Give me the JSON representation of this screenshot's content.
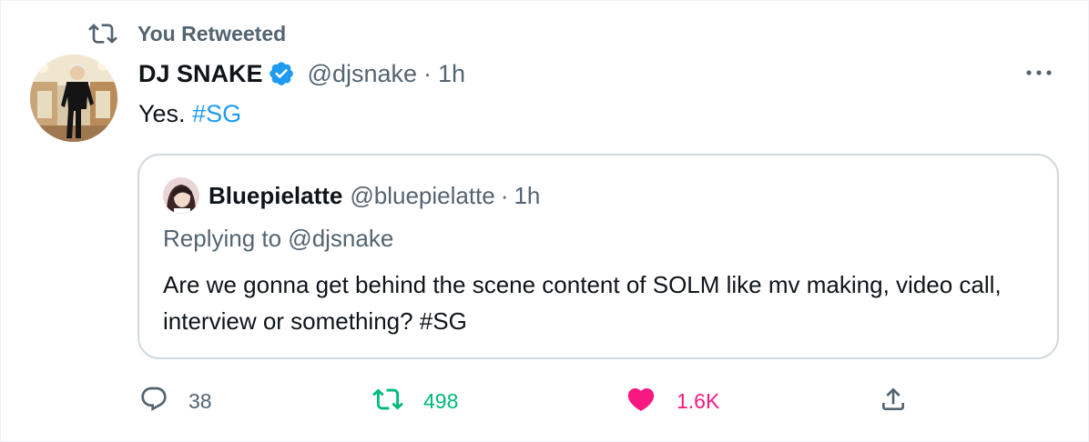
{
  "social_context": {
    "text": "You Retweeted",
    "icon": "retweet-icon"
  },
  "author": {
    "display_name": "DJ SNAKE",
    "handle": "@djsnake",
    "separator": "·",
    "time": "1h",
    "verified": true
  },
  "tweet": {
    "text": "Yes.",
    "hashtag": "#SG"
  },
  "quote": {
    "display_name": "Bluepielatte",
    "handle": "@bluepielatte",
    "separator": "·",
    "time": "1h",
    "replying_to": "Replying to @djsnake",
    "text": "Are we gonna get behind the scene content of SOLM like mv making, video call, interview or something? #SG"
  },
  "actions": {
    "replies": "38",
    "retweets": "498",
    "likes": "1.6K"
  },
  "colors": {
    "accent": "#1d9bf0",
    "muted": "#536471",
    "retweet_active": "#00ba7c",
    "like_active": "#f91880",
    "border": "#cfd9de"
  },
  "icons": [
    "retweet-icon",
    "verified-badge-icon",
    "more-icon",
    "reply-icon",
    "like-icon",
    "share-icon"
  ]
}
